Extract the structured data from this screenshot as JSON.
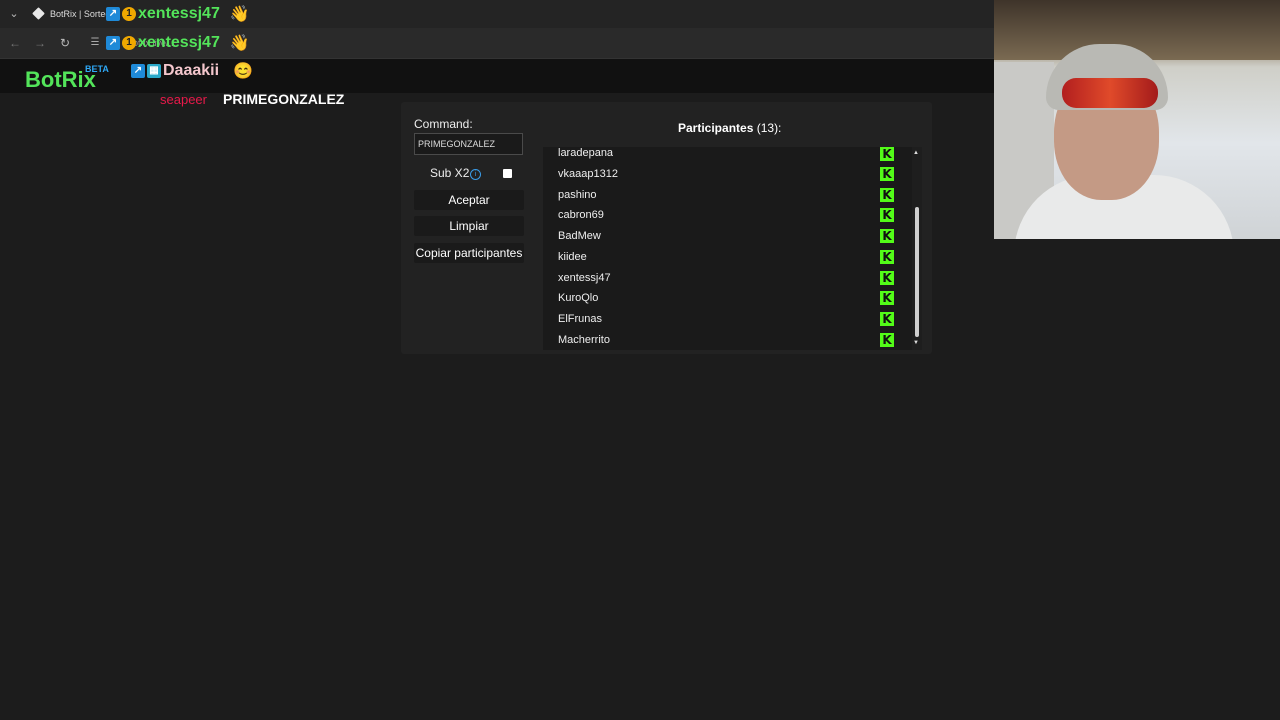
{
  "browser": {
    "tab_title": "BotRix | Sorteos",
    "url": "botrix.live/..."
  },
  "chat": [
    {
      "user": "xentessj47",
      "color": "#53e45a",
      "badges": [
        "blue",
        "gold"
      ],
      "emote": "👋"
    },
    {
      "user": "xentessj47",
      "color": "#53e45a",
      "badges": [
        "blue",
        "gold"
      ],
      "emote": "👋"
    },
    {
      "user": "Daaakii",
      "color": "#f3c6cc",
      "badges": [
        "blue",
        "teal"
      ],
      "emote": "😊"
    }
  ],
  "botrix": {
    "logo": "BotRix",
    "beta": "BETA",
    "previous_winner": "seapeer",
    "winner": "PRIMEGONZALEZ"
  },
  "panel": {
    "command_label": "Command:",
    "command_value": "PRIMEGONZALEZ",
    "sub_x2_label": "Sub X2",
    "sub_x2_checked": false,
    "accept_label": "Aceptar",
    "clear_label": "Limpiar",
    "copy_label": "Copiar participantes",
    "participants_title": "Participantes",
    "participants_count": "(13):",
    "participants": [
      "laradepana",
      "vkaaap1312",
      "pashino",
      "cabron69",
      "BadMew",
      "kiidee",
      "xentessj47",
      "KuroQlo",
      "ElFrunas",
      "Macherrito"
    ]
  },
  "colors": {
    "kick_green": "#53fc18",
    "botrix_green": "#53e45a",
    "winner_red": "#e8194a"
  }
}
